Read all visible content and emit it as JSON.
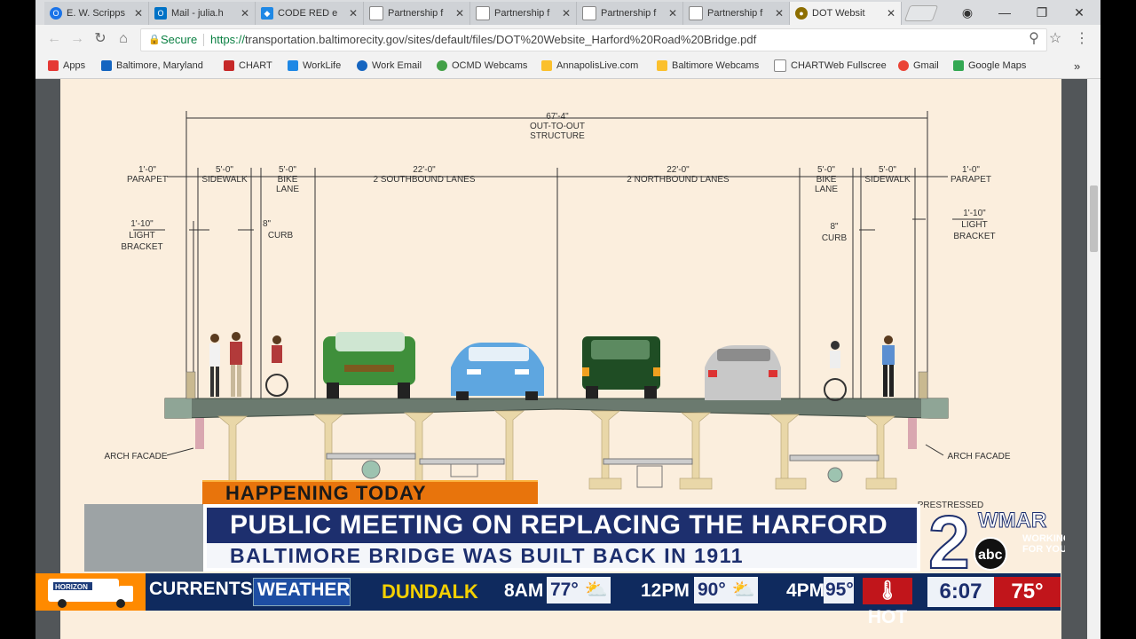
{
  "browser": {
    "tabs": [
      {
        "title": "E. W. Scripps",
        "icon_color": "#1a73e8"
      },
      {
        "title": "Mail - julia.h",
        "icon_color": "#0072c6"
      },
      {
        "title": "CODE RED e",
        "icon_color": "#1e88e5"
      },
      {
        "title": "Partnership f",
        "icon_color": "#9e9e9e"
      },
      {
        "title": "Partnership f",
        "icon_color": "#9e9e9e"
      },
      {
        "title": "Partnership f",
        "icon_color": "#9e9e9e"
      },
      {
        "title": "Partnership f",
        "icon_color": "#9e9e9e"
      },
      {
        "title": "DOT Websit",
        "icon_color": "#8d6e00"
      }
    ],
    "secure_label": "Secure",
    "url_scheme": "https://",
    "url_rest": "transportation.baltimorecity.gov/sites/default/files/DOT%20Website_Harford%20Road%20Bridge.pdf",
    "bookmarks": [
      {
        "label": "Apps",
        "icon_color": "#e53935"
      },
      {
        "label": "Baltimore, Maryland",
        "icon_color": "#1565c0"
      },
      {
        "label": "CHART",
        "icon_color": "#c62828"
      },
      {
        "label": "WorkLife",
        "icon_color": "#1e88e5"
      },
      {
        "label": "Work Email",
        "icon_color": "#1565c0"
      },
      {
        "label": "OCMD Webcams",
        "icon_color": "#43a047"
      },
      {
        "label": "AnnapolisLive.com",
        "icon_color": "#fbc02d"
      },
      {
        "label": "Baltimore Webcams",
        "icon_color": "#fbc02d"
      },
      {
        "label": "CHARTWeb Fullscree",
        "icon_color": "#9e9e9e"
      },
      {
        "label": "Gmail",
        "icon_color": "#ea4335"
      },
      {
        "label": "Google Maps",
        "icon_color": "#34a853"
      }
    ],
    "more_bookmarks": "»"
  },
  "drawing": {
    "overall": {
      "dim": "67'-4\"",
      "label": "OUT-TO-OUT STRUCTURE"
    },
    "left": {
      "parapet_dim": "1'-0\"",
      "parapet": "PARAPET",
      "sidewalk_dim": "5'-0\"",
      "sidewalk": "SIDEWALK",
      "bike_dim": "5'-0\"",
      "bike1": "BIKE",
      "bike2": "LANE",
      "lanes_dim": "22'-0\"",
      "lanes": "2 SOUTHBOUND LANES",
      "bracket_dim": "1'-10\"",
      "bracket1": "LIGHT",
      "bracket2": "BRACKET",
      "curb_dim": "8\"",
      "curb": "CURB",
      "facade": "ARCH FACADE"
    },
    "right": {
      "lanes_dim": "22'-0\"",
      "lanes": "2 NORTHBOUND LANES",
      "bike_dim": "5'-0\"",
      "bike1": "BIKE",
      "bike2": "LANE",
      "sidewalk_dim": "5'-0\"",
      "sidewalk": "SIDEWALK",
      "parapet_dim": "1'-0\"",
      "parapet": "PARAPET",
      "curb_dim": "8\"",
      "curb": "CURB",
      "bracket_dim": "1'-10\"",
      "bracket1": "LIGHT",
      "bracket2": "BRACKET",
      "facade": "ARCH FACADE",
      "prestressed": "PRESTRESSED"
    }
  },
  "broadcast": {
    "tag": "HAPPENING TODAY",
    "headline": "PUBLIC MEETING ON REPLACING THE HARFORD RD. BRIDGE",
    "subhead": "BALTIMORE BRIDGE WAS BUILT BACK IN 1911",
    "station_number": "2",
    "station_name": "WMAR",
    "network": "abc",
    "slogan1": "WORKING",
    "slogan2": "FOR YOU",
    "ticker": {
      "advertiser": "HORIZON",
      "section": "CURRENTS",
      "category": "WEATHER",
      "city": "DUNDALK",
      "forecast": [
        {
          "time": "8AM",
          "temp": "77°"
        },
        {
          "time": "12PM",
          "temp": "90°"
        },
        {
          "time": "4PM",
          "temp": "95°"
        }
      ],
      "alert": "HOT"
    },
    "clock": "6:07",
    "current_temp": "75°"
  }
}
